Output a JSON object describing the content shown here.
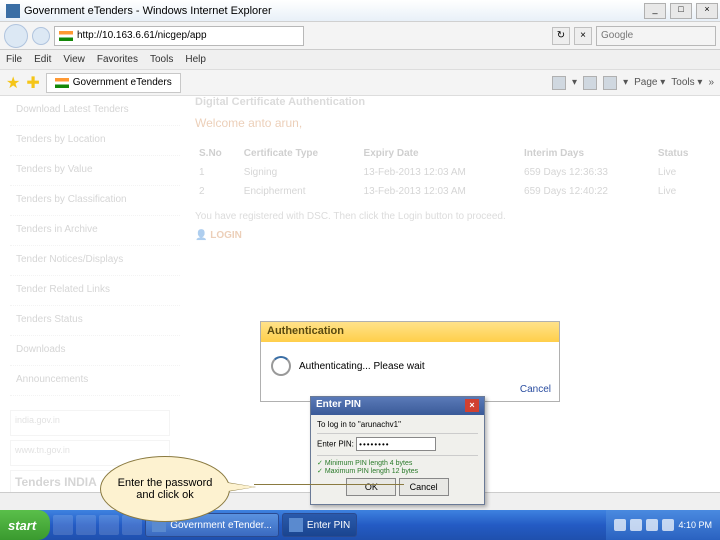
{
  "window": {
    "title": "Government eTenders - Windows Internet Explorer"
  },
  "nav": {
    "url": "http://10.163.6.61/nicgep/app",
    "search_placeholder": "Google"
  },
  "menu": [
    "File",
    "Edit",
    "View",
    "Favorites",
    "Tools",
    "Help"
  ],
  "tab": {
    "label": "Government eTenders"
  },
  "toolbar": {
    "page": "Page",
    "tools": "Tools",
    "chev": "▾"
  },
  "sidebar": {
    "items": [
      "Download Latest Tenders",
      "Tenders by Location",
      "Tenders by Value",
      "Tenders by Classification",
      "Tenders in Archive",
      "Tender Notices/Displays",
      "Tender Related Links",
      "Tenders Status",
      "Downloads",
      "Announcements"
    ]
  },
  "main": {
    "heading": "Digital Certificate Authentication",
    "welcome": "Welcome anto arun,",
    "headers": {
      "sno": "S.No",
      "type": "Certificate Type",
      "expiry": "Expiry Date",
      "interim": "Interim Days",
      "status": "Status"
    },
    "rows": [
      {
        "sno": "1",
        "type": "Signing",
        "expiry": "13-Feb-2013 12:03 AM",
        "interim": "659 Days 12:36:33",
        "status": "Live"
      },
      {
        "sno": "2",
        "type": "Encipherment",
        "expiry": "13-Feb-2013 12:03 AM",
        "interim": "659 Days 12:40:22",
        "status": "Live"
      }
    ],
    "reginfo": "You have registered with DSC. Then click the Login button to proceed.",
    "login": "LOGIN"
  },
  "logos": {
    "india": "india.gov.in",
    "tn": "www.tn.gov.in",
    "tenders": "Tenders INDIA"
  },
  "auth": {
    "title": "Authentication",
    "msg": "Authenticating... Please wait",
    "cancel": "Cancel"
  },
  "pin": {
    "title": "Enter PIN",
    "prompt": "To log in to \"arunachv1\"",
    "label": "Enter PIN:",
    "value": "••••••••",
    "hint1": "Minimum PIN length 4 bytes",
    "hint2": "Maximum PIN length 12 bytes",
    "ok": "OK",
    "cancel": "Cancel"
  },
  "callout": {
    "text": "Enter the password and click ok"
  },
  "taskbar": {
    "start": "start",
    "items": [
      {
        "label": "Government eTender..."
      },
      {
        "label": "Enter PIN"
      }
    ],
    "clock": "4:10 PM"
  }
}
